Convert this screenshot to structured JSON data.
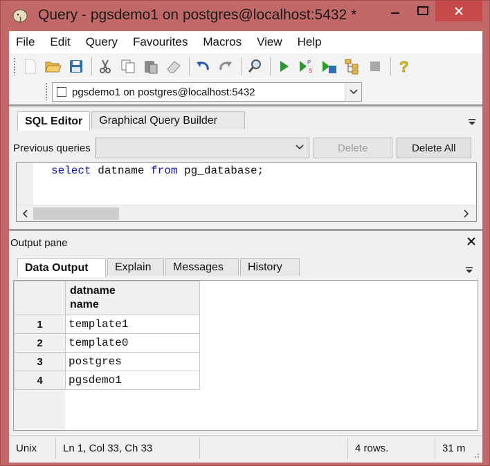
{
  "window": {
    "title": "Query - pgsdemo1 on postgres@localhost:5432 *",
    "minimize_glyph": "—",
    "maximize_glyph": "☐",
    "close_glyph": "✕"
  },
  "menu": [
    {
      "label": "File"
    },
    {
      "label": "Edit"
    },
    {
      "label": "Query"
    },
    {
      "label": "Favourites"
    },
    {
      "label": "Macros"
    },
    {
      "label": "View"
    },
    {
      "label": "Help"
    }
  ],
  "connection": {
    "selected": "pgsdemo1 on postgres@localhost:5432"
  },
  "sql_editor": {
    "tabs": [
      "SQL Editor",
      "Graphical Query Builder"
    ],
    "active_tab": "SQL Editor",
    "previous_queries_label": "Previous queries",
    "previous_queries_value": "",
    "delete_label": "Delete",
    "delete_all_label": "Delete All",
    "query": {
      "kw1": "select",
      "t1": " datname ",
      "kw2": "from",
      "t2": " pg_database;"
    }
  },
  "output": {
    "title": "Output pane",
    "tabs": [
      "Data Output",
      "Explain",
      "Messages",
      "History"
    ],
    "active_tab": "Data Output",
    "column": {
      "name": "datname",
      "type": "name"
    },
    "rows": [
      {
        "num": "1",
        "value": "template1"
      },
      {
        "num": "2",
        "value": "template0"
      },
      {
        "num": "3",
        "value": "postgres"
      },
      {
        "num": "4",
        "value": "pgsdemo1"
      }
    ]
  },
  "status": {
    "line_endings": "Unix",
    "position": "Ln 1, Col 33, Ch 33",
    "empty": "",
    "rows": "4 rows.",
    "time": "31 m"
  },
  "colors": {
    "window_frame": "#c36868",
    "close_button": "#c74a4a",
    "keyword": "#1010c0",
    "run_green": "#2a9a2a"
  }
}
